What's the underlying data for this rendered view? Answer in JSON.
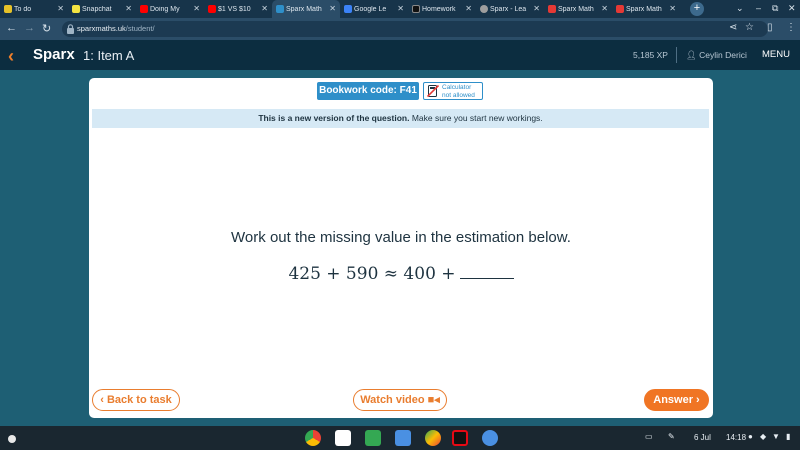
{
  "browser": {
    "tabs": [
      {
        "label": "To do",
        "color": "#e6c229",
        "active": false
      },
      {
        "label": "Snapchat",
        "color": "#f4e542",
        "active": false
      },
      {
        "label": "Doing My",
        "color": "#ff0000",
        "active": false
      },
      {
        "label": "$1 VS $10",
        "color": "#ff0000",
        "active": false
      },
      {
        "label": "Sparx Math",
        "color": "#2e8fc9",
        "active": true
      },
      {
        "label": "Google Le",
        "color": "#3b82f6",
        "active": false
      },
      {
        "label": "Homework",
        "color": "#111111",
        "active": false
      },
      {
        "label": "Sparx - Lea",
        "color": "#9e9e9e",
        "active": false
      },
      {
        "label": "Sparx Math",
        "color": "#e53935",
        "active": false
      },
      {
        "label": "Sparx Math",
        "color": "#e53935",
        "active": false
      }
    ],
    "new_tab_label": "+",
    "url_host": "sparxmaths.uk",
    "url_path": "/student/"
  },
  "header": {
    "logo": "Sparx",
    "item_title": "1: Item A",
    "xp": "5,185 XP",
    "user_name": "Ceylin Derici",
    "menu_label": "MENU"
  },
  "question": {
    "bookwork_code": "Bookwork code: F41",
    "calculator_line1": "Calculator",
    "calculator_line2": "not allowed",
    "notice_bold": "This is a new version of the question.",
    "notice_rest": " Make sure you start new workings.",
    "prompt": "Work out the missing value in the estimation below.",
    "expression": "425 + 590 ≈ 400 +"
  },
  "buttons": {
    "back": "Back to task",
    "video": "Watch video",
    "answer": "Answer"
  },
  "shelf": {
    "date": "6 Jul",
    "time": "14:18",
    "apps": [
      "chrome-icon",
      "gmail-icon",
      "classroom-icon",
      "files-icon",
      "play-store-icon",
      "netflix-icon",
      "chat-icon"
    ]
  },
  "colors": {
    "sparx_orange": "#f07524",
    "sparx_blue": "#2e8fc9",
    "header_navy": "#0c2d40",
    "page_teal": "#1e5f74"
  }
}
